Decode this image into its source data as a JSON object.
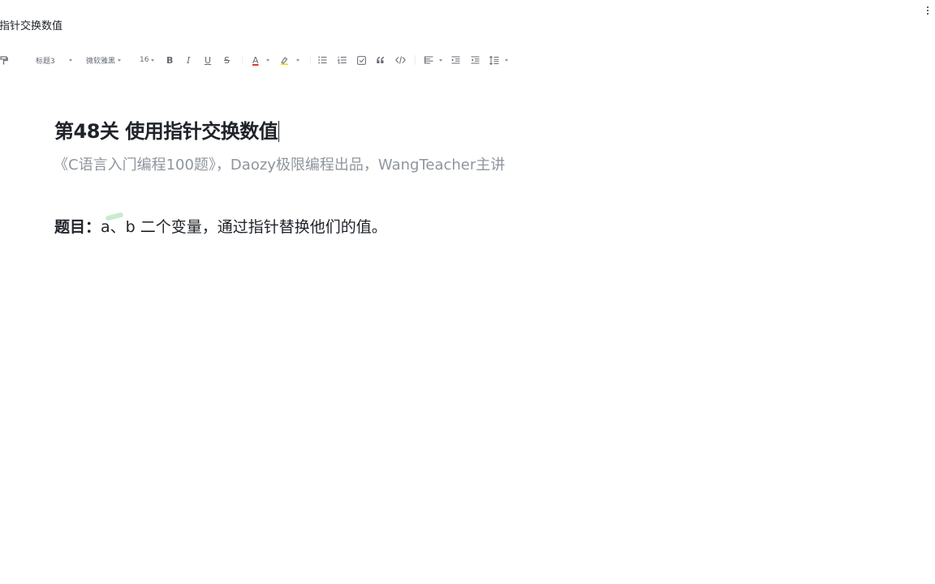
{
  "document": {
    "title": "用指针交换数值"
  },
  "toolbar": {
    "paragraph_style": "标题3",
    "font_family": "微软雅黑",
    "font_size": "16",
    "bold": "B",
    "italic": "I",
    "underline": "U",
    "strikethrough": "S",
    "font_color": "A",
    "highlight_color": "#f5d800",
    "font_color_value": "#d83931"
  },
  "content": {
    "heading": "第48关 使用指针交换数值",
    "subtitle": "《C语言入门编程100题》，Daozy极限编程出品，WangTeacher主讲",
    "question_label": "题目：",
    "question_text": "a、b 二个变量，通过指针替换他们的值。"
  }
}
